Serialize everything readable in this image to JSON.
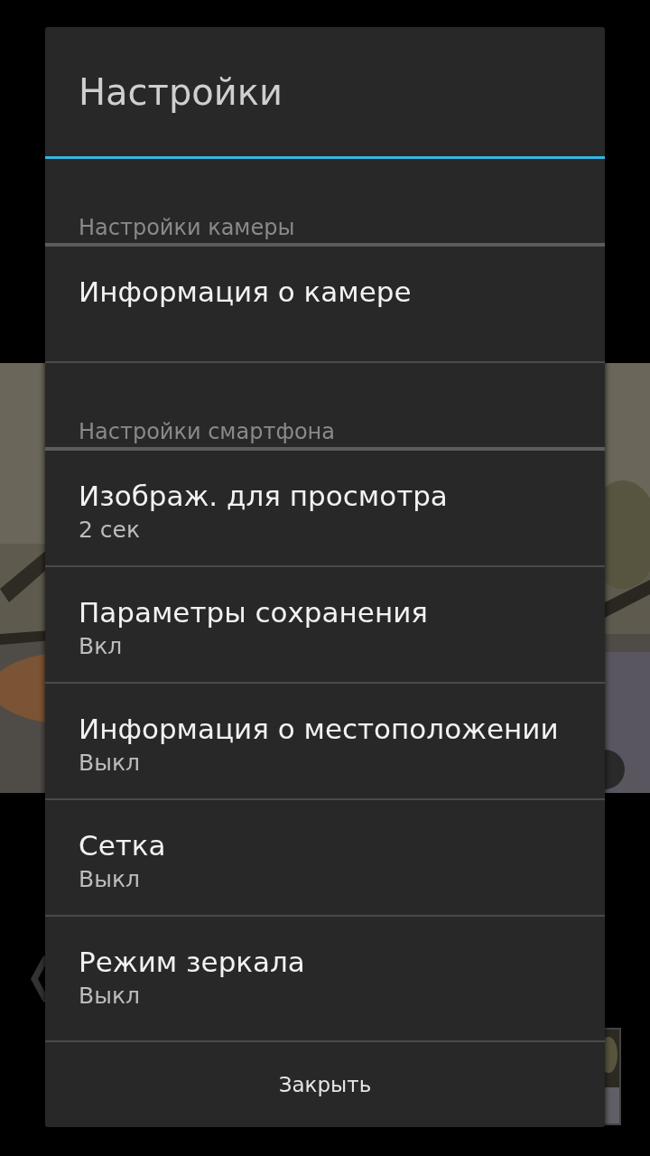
{
  "dialog": {
    "title": "Настройки",
    "sections": [
      {
        "header": "Настройки камеры",
        "items": [
          {
            "title": "Информация о камере"
          }
        ]
      },
      {
        "header": "Настройки смартфона",
        "items": [
          {
            "title": "Изображ. для просмотра",
            "summary": "2 сек"
          },
          {
            "title": "Параметры сохранения",
            "summary": "Вкл"
          },
          {
            "title": "Информация о местоположении",
            "summary": "Выкл"
          },
          {
            "title": "Сетка",
            "summary": "Выкл"
          },
          {
            "title": "Режим зеркала",
            "summary": "Выкл"
          }
        ]
      }
    ],
    "close_button": "Закрыть"
  }
}
